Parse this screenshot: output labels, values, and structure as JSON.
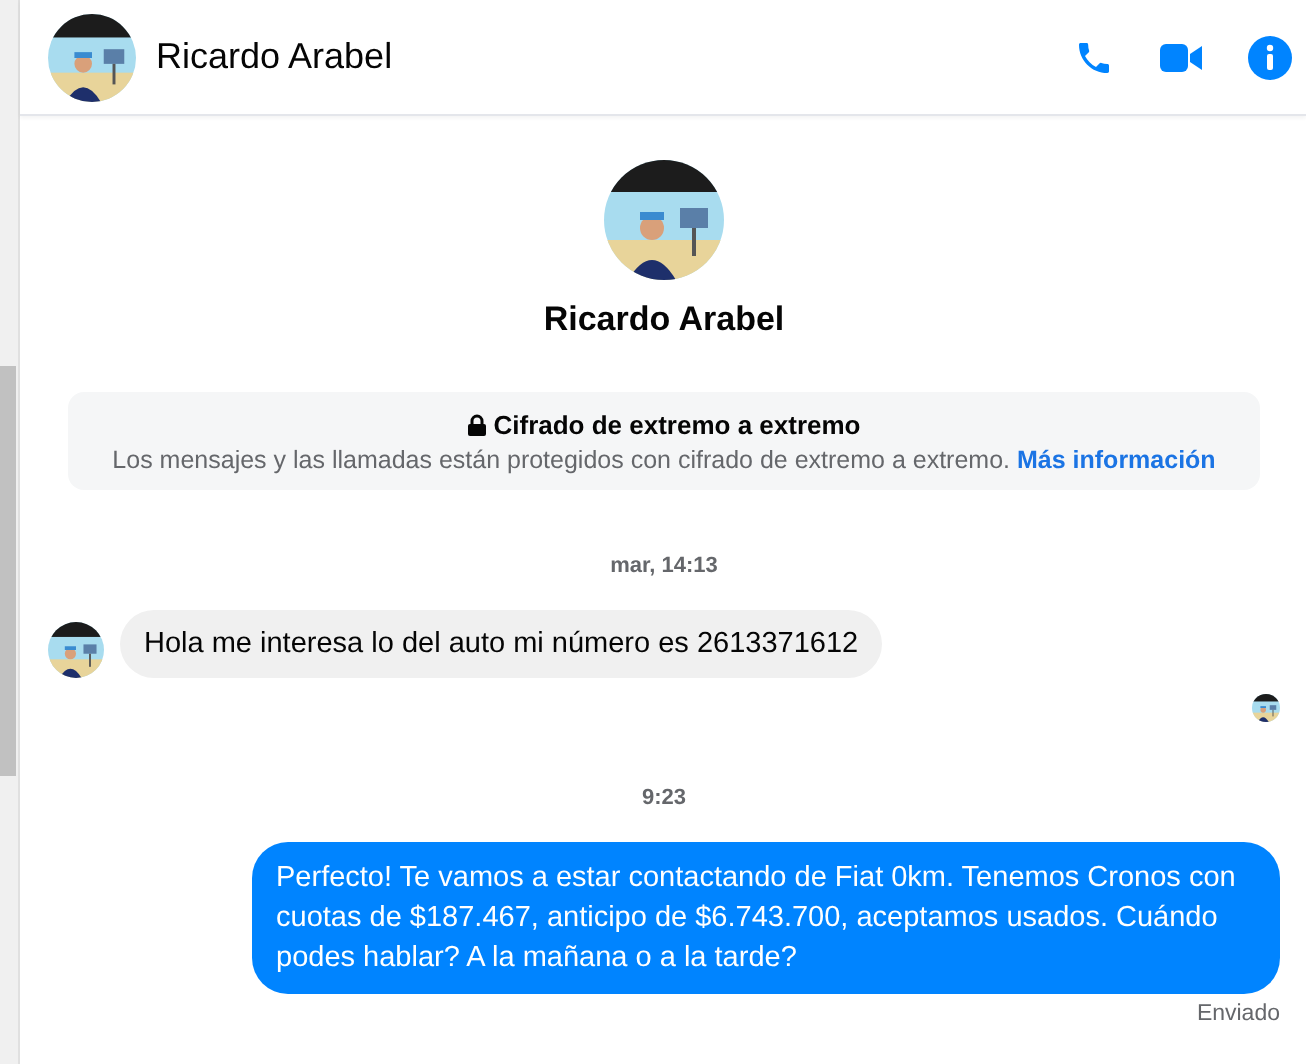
{
  "header": {
    "name": "Ricardo Arabel",
    "actions": [
      {
        "kind": "call"
      },
      {
        "kind": "video"
      },
      {
        "kind": "info"
      }
    ]
  },
  "profile": {
    "name": "Ricardo Arabel"
  },
  "encryption": {
    "title": "Cifrado de extremo a extremo",
    "text": "Los mensajes y las llamadas están protegidos con cifrado de extremo a extremo.",
    "link": "Más información"
  },
  "messages": [
    {
      "kind": "timestamp",
      "text": "mar, 14:13"
    },
    {
      "kind": "incoming",
      "text": "Hola me interesa lo del auto mi número es 2613371612"
    },
    {
      "kind": "seen"
    },
    {
      "kind": "timestamp",
      "text": "9:23"
    },
    {
      "kind": "outgoing",
      "text": "Perfecto! Te vamos a estar contactando de Fiat 0km. Tenemos Cronos con cuotas de $187.467, anticipo de $6.743.700, aceptamos usados. Cuándo podes hablar? A la mañana o a la tarde?",
      "status": "Enviado"
    }
  ]
}
